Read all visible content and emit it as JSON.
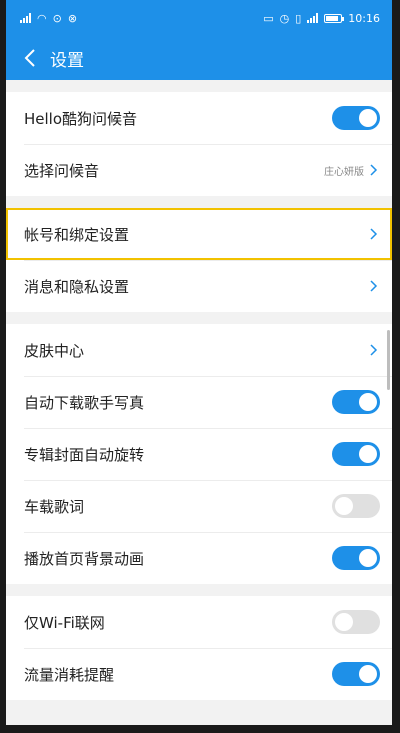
{
  "status": {
    "time": "10:16"
  },
  "header": {
    "title": "设置"
  },
  "groups": [
    [
      {
        "label": "Hello酷狗问候音",
        "toggle": true
      },
      {
        "label": "选择问候音",
        "value": "庄心妍版"
      }
    ],
    [
      {
        "label": "帐号和绑定设置",
        "highlighted": true
      },
      {
        "label": "消息和隐私设置"
      }
    ],
    [
      {
        "label": "皮肤中心"
      },
      {
        "label": "自动下载歌手写真",
        "toggle": true
      },
      {
        "label": "专辑封面自动旋转",
        "toggle": true
      },
      {
        "label": "车载歌词",
        "toggle": false
      },
      {
        "label": "播放首页背景动画",
        "toggle": true
      }
    ],
    [
      {
        "label": "仅Wi-Fi联网",
        "toggle": false
      },
      {
        "label": "流量消耗提醒",
        "toggle": true
      }
    ]
  ],
  "colors": {
    "accent": "#1e90e8",
    "highlight": "#f2c200",
    "toggle_off": "#e0e0e0"
  }
}
